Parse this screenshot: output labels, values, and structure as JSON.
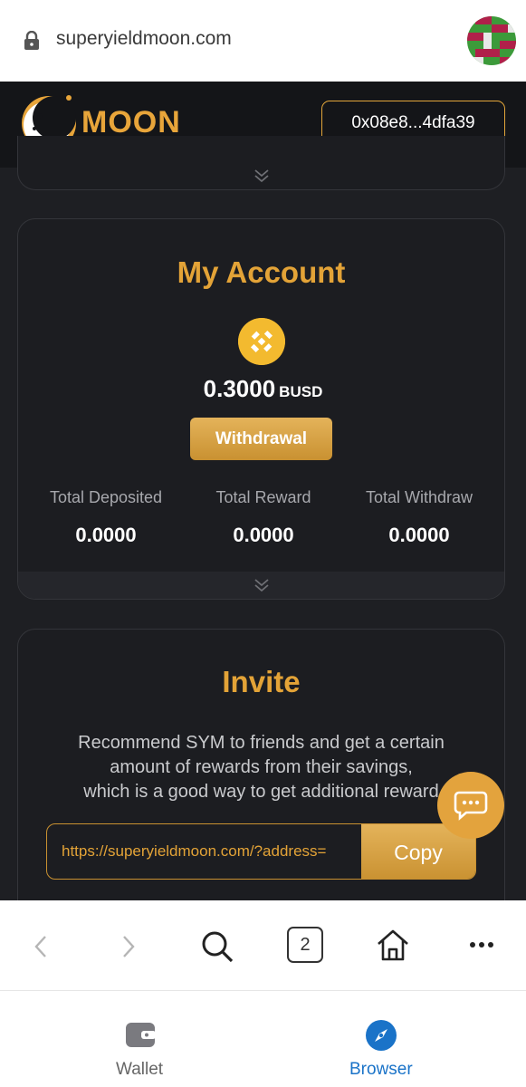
{
  "browser": {
    "url": "superyieldmoon.com",
    "tabs_count": "2"
  },
  "header": {
    "logo_text": "MOON",
    "wallet_address": "0x08e8...4dfa39"
  },
  "account": {
    "title": "My Account",
    "balance": "0.3000",
    "unit": "BUSD",
    "withdraw_label": "Withdrawal",
    "stats": [
      {
        "label": "Total Deposited",
        "value": "0.0000"
      },
      {
        "label": "Total Reward",
        "value": "0.0000"
      },
      {
        "label": "Total Withdraw",
        "value": "0.0000"
      }
    ]
  },
  "invite": {
    "title": "Invite",
    "desc_line1": "Recommend SYM to friends and get a certain",
    "desc_line2": "amount of rewards from their savings,",
    "desc_line3": "which is a good way to get additional reward",
    "ref_url": "https://superyieldmoon.com/?address=",
    "copy_label": "Copy"
  },
  "bottom_nav": {
    "wallet_label": "Wallet",
    "browser_label": "Browser"
  },
  "colors": {
    "accent": "#e3a337",
    "background": "#1e1f23",
    "active_nav": "#1a73c8"
  }
}
